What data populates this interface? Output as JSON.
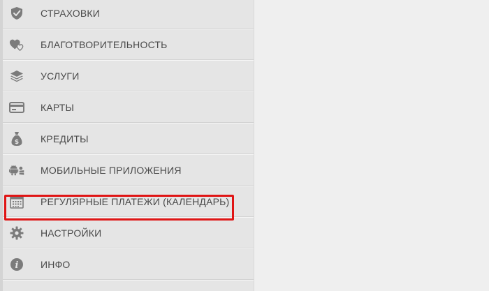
{
  "menu": {
    "items": [
      {
        "label": "СТРАХОВКИ",
        "icon": "shield-check-icon"
      },
      {
        "label": "БЛАГОТВОРИТЕЛЬНОСТЬ",
        "icon": "hearts-icon"
      },
      {
        "label": "УСЛУГИ",
        "icon": "layers-icon"
      },
      {
        "label": "КАРТЫ",
        "icon": "credit-card-icon"
      },
      {
        "label": "КРЕДИТЫ",
        "icon": "money-bag-icon"
      },
      {
        "label": "МОБИЛЬНЫЕ ПРИЛОЖЕНИЯ",
        "icon": "mobile-platforms-icon"
      },
      {
        "label": "РЕГУЛЯРНЫЕ ПЛАТЕЖИ (КАЛЕНДАРЬ)",
        "icon": "calendar-icon"
      },
      {
        "label": "НАСТРОЙКИ",
        "icon": "gear-icon"
      },
      {
        "label": "ИНФО",
        "icon": "info-icon"
      }
    ],
    "highlighted_item": "РЕГУЛЯРНЫЕ ПЛАТЕЖИ (КАЛЕНДАРЬ)"
  },
  "colors": {
    "icon": "#7b7b7b",
    "label": "#4a4a4a",
    "highlight_border": "#e01515",
    "sidebar_bg": "#e5e5e5",
    "content_bg": "#efefef"
  }
}
